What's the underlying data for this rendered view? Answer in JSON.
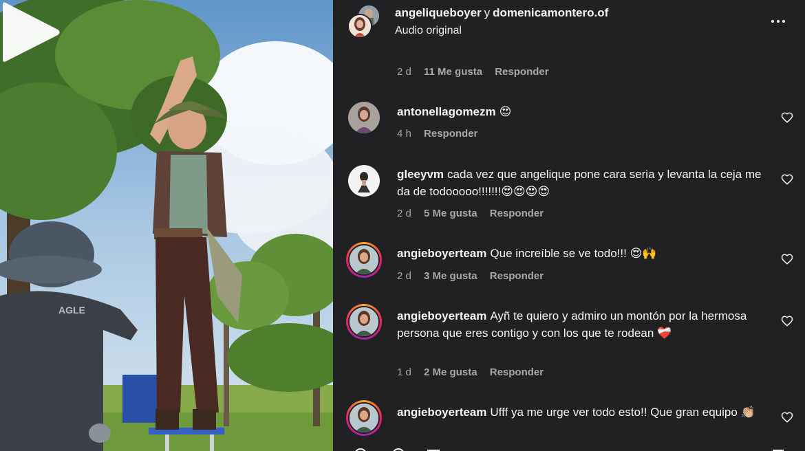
{
  "header": {
    "user1": "angeliqueboyer",
    "connector": "y",
    "user2": "domenicamontero.of",
    "audio": "Audio original"
  },
  "top_meta": {
    "time": "2 d",
    "likes": "11 Me gusta",
    "reply": "Responder"
  },
  "comments": [
    {
      "user": "antonellagomezm",
      "text": "😍",
      "time": "4 h",
      "likes": "",
      "reply": "Responder"
    },
    {
      "user": "gleeyvm",
      "text": "cada vez que angelique pone cara seria y levanta la ceja me da de todooooo!!!!!!!😍😍😍😍",
      "time": "2 d",
      "likes": "5 Me gusta",
      "reply": "Responder"
    },
    {
      "user": "angieboyerteam",
      "text": "Que increíble se ve todo!!! 😍🙌",
      "time": "2 d",
      "likes": "3 Me gusta",
      "reply": "Responder"
    },
    {
      "user": "angieboyerteam",
      "text": "Ayñ te quiero y admiro un montón por la hermosa persona que eres contigo y con los que te rodean ❤️‍🩹",
      "time": "1 d",
      "likes": "2 Me gusta",
      "reply": "Responder"
    },
    {
      "user": "angieboyerteam",
      "text": "Ufff ya me urge ver todo esto!! Que gran equipo 👏🏼",
      "time": "",
      "likes": "",
      "reply": ""
    }
  ],
  "colors": {
    "panel_bg": "#212124",
    "text_primary": "#f5f5f5",
    "text_secondary": "#a8a8a8",
    "story_ring": "#e91e63"
  },
  "icons": {
    "more": "more-horizontal-icon",
    "like": "heart-outline-icon",
    "play": "play-icon"
  }
}
